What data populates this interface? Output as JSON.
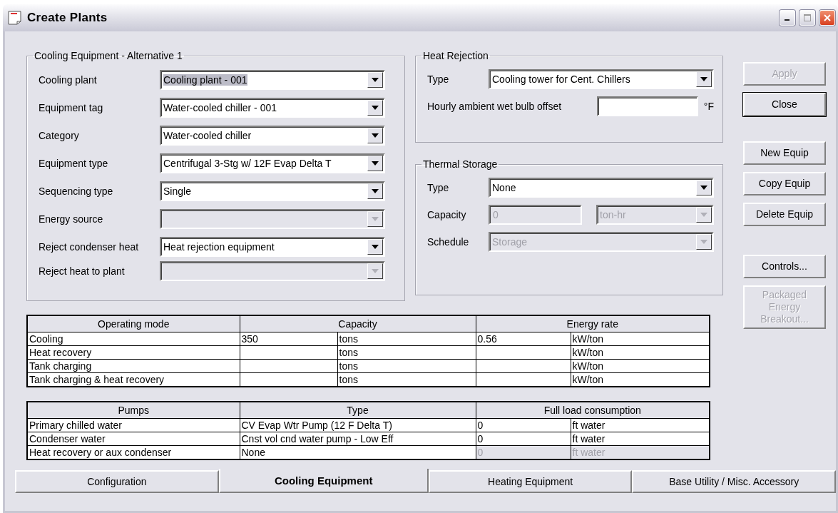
{
  "window": {
    "title": "Create Plants"
  },
  "cooling_equipment": {
    "title": "Cooling Equipment - Alternative 1",
    "fields": [
      {
        "label": "Cooling plant",
        "value": "Cooling plant - 001",
        "disabled": false,
        "highlighted": true
      },
      {
        "label": "Equipment tag",
        "value": "Water-cooled chiller - 001",
        "disabled": false,
        "highlighted": false
      },
      {
        "label": "Category",
        "value": "Water-cooled chiller",
        "disabled": false,
        "highlighted": false
      },
      {
        "label": "Equipment type",
        "value": "Centrifugal 3-Stg w/ 12F Evap Delta T",
        "disabled": false,
        "highlighted": false
      },
      {
        "label": "Sequencing type",
        "value": "Single",
        "disabled": false,
        "highlighted": false
      },
      {
        "label": "Energy source",
        "disabled": true,
        "highlighted": false
      },
      {
        "label": "Reject condenser heat",
        "value": "Heat rejection equipment",
        "disabled": false,
        "highlighted": false
      },
      {
        "label": "Reject heat to plant",
        "disabled": true,
        "highlighted": false
      }
    ]
  },
  "heat_rejection": {
    "title": "Heat Rejection",
    "type": {
      "label": "Type",
      "value": "Cooling tower for Cent. Chillers",
      "disabled": false
    },
    "offset": {
      "label": "Hourly ambient wet bulb offset",
      "unit": "°F"
    }
  },
  "thermal_storage": {
    "title": "Thermal Storage",
    "fields": [
      {
        "kind": "combo",
        "label": "Type",
        "value": "None",
        "disabled": false
      },
      {
        "kind": "text_combo",
        "label": "Capacity",
        "value": "0",
        "unit": "ton-hr",
        "disabled": true
      },
      {
        "kind": "combo",
        "label": "Schedule",
        "value": "Storage",
        "disabled": true
      }
    ]
  },
  "button_groups": [
    [
      {
        "label": "Apply",
        "disabled": true,
        "default": false
      },
      {
        "label": "Close",
        "disabled": false,
        "default": true
      }
    ],
    [
      {
        "label": "New Equip",
        "disabled": false,
        "default": false
      },
      {
        "label": "Copy Equip",
        "disabled": false,
        "default": false
      },
      {
        "label": "Delete Equip",
        "disabled": false,
        "default": false
      }
    ],
    [
      {
        "label": "Controls...",
        "disabled": false,
        "default": false
      },
      {
        "label": "Packaged Energy Breakout...",
        "disabled": true,
        "default": false
      }
    ]
  ],
  "operating_table": {
    "columns": [
      "Operating mode",
      "Capacity",
      "Energy rate"
    ],
    "rows": [
      {
        "mode": "Cooling",
        "capacity": "350",
        "capacity_unit": "tons",
        "energy_rate": "0.56",
        "energy_unit": "kW/ton"
      },
      {
        "mode": "Heat recovery",
        "capacity_unit": "tons",
        "energy_unit": "kW/ton"
      },
      {
        "mode": "Tank charging",
        "capacity_unit": "tons",
        "energy_unit": "kW/ton"
      },
      {
        "mode": "Tank charging & heat recovery",
        "capacity_unit": "tons",
        "energy_unit": "kW/ton"
      }
    ]
  },
  "pumps_table": {
    "columns": [
      "Pumps",
      "Type",
      "Full load consumption"
    ],
    "rows": [
      {
        "name": "Primary chilled water",
        "type": "CV Evap Wtr Pump (12 F Delta T)",
        "consumption": "0",
        "unit": "ft water",
        "disabled": false
      },
      {
        "name": "Condenser water",
        "type": "Cnst vol cnd water pump - Low Eff",
        "consumption": "0",
        "unit": "ft water",
        "disabled": false
      },
      {
        "name": "Heat recovery or aux condenser",
        "type": "None",
        "consumption": "0",
        "unit": "ft water",
        "disabled": true
      }
    ]
  },
  "tabs": [
    {
      "label": "Configuration",
      "selected": false
    },
    {
      "label": "Cooling Equipment",
      "selected": true
    },
    {
      "label": "Heating Equipment",
      "selected": false
    },
    {
      "label": "Base Utility / Misc. Accessory",
      "selected": false
    }
  ]
}
